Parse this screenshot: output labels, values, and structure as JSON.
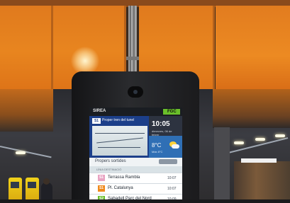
{
  "kiosk": {
    "screen_brand": "SIREA",
    "operator_logo": "FGC",
    "next_trains_label": "Proper tren del tunel",
    "line_badge": "S1",
    "clock": "10:05",
    "date_text": "dimecres, 06 de febrer",
    "temperature": "8°C",
    "weather_note": "Màx 8°C",
    "departures_title": "Propers sortides",
    "column_header": "LÍNIA  DESTINACIÓ",
    "departures": [
      {
        "line": "S1",
        "line_color": "#e8a3c2",
        "destination": "Terrassa Rambla",
        "time": "10:07"
      },
      {
        "line": "S1",
        "line_color": "#f08a1d",
        "destination": "Pl. Catalunya",
        "time": "10:07"
      },
      {
        "line": "S2",
        "line_color": "#6abf2a",
        "destination": "Sabadell Parc del Nord",
        "time": "10:09"
      }
    ]
  },
  "colors": {
    "wall_orange": "#e8851f",
    "kiosk_frame": "#1b1b1d",
    "screen_header_blue": "#1c3f8a",
    "fgc_green": "#6abf2a"
  }
}
